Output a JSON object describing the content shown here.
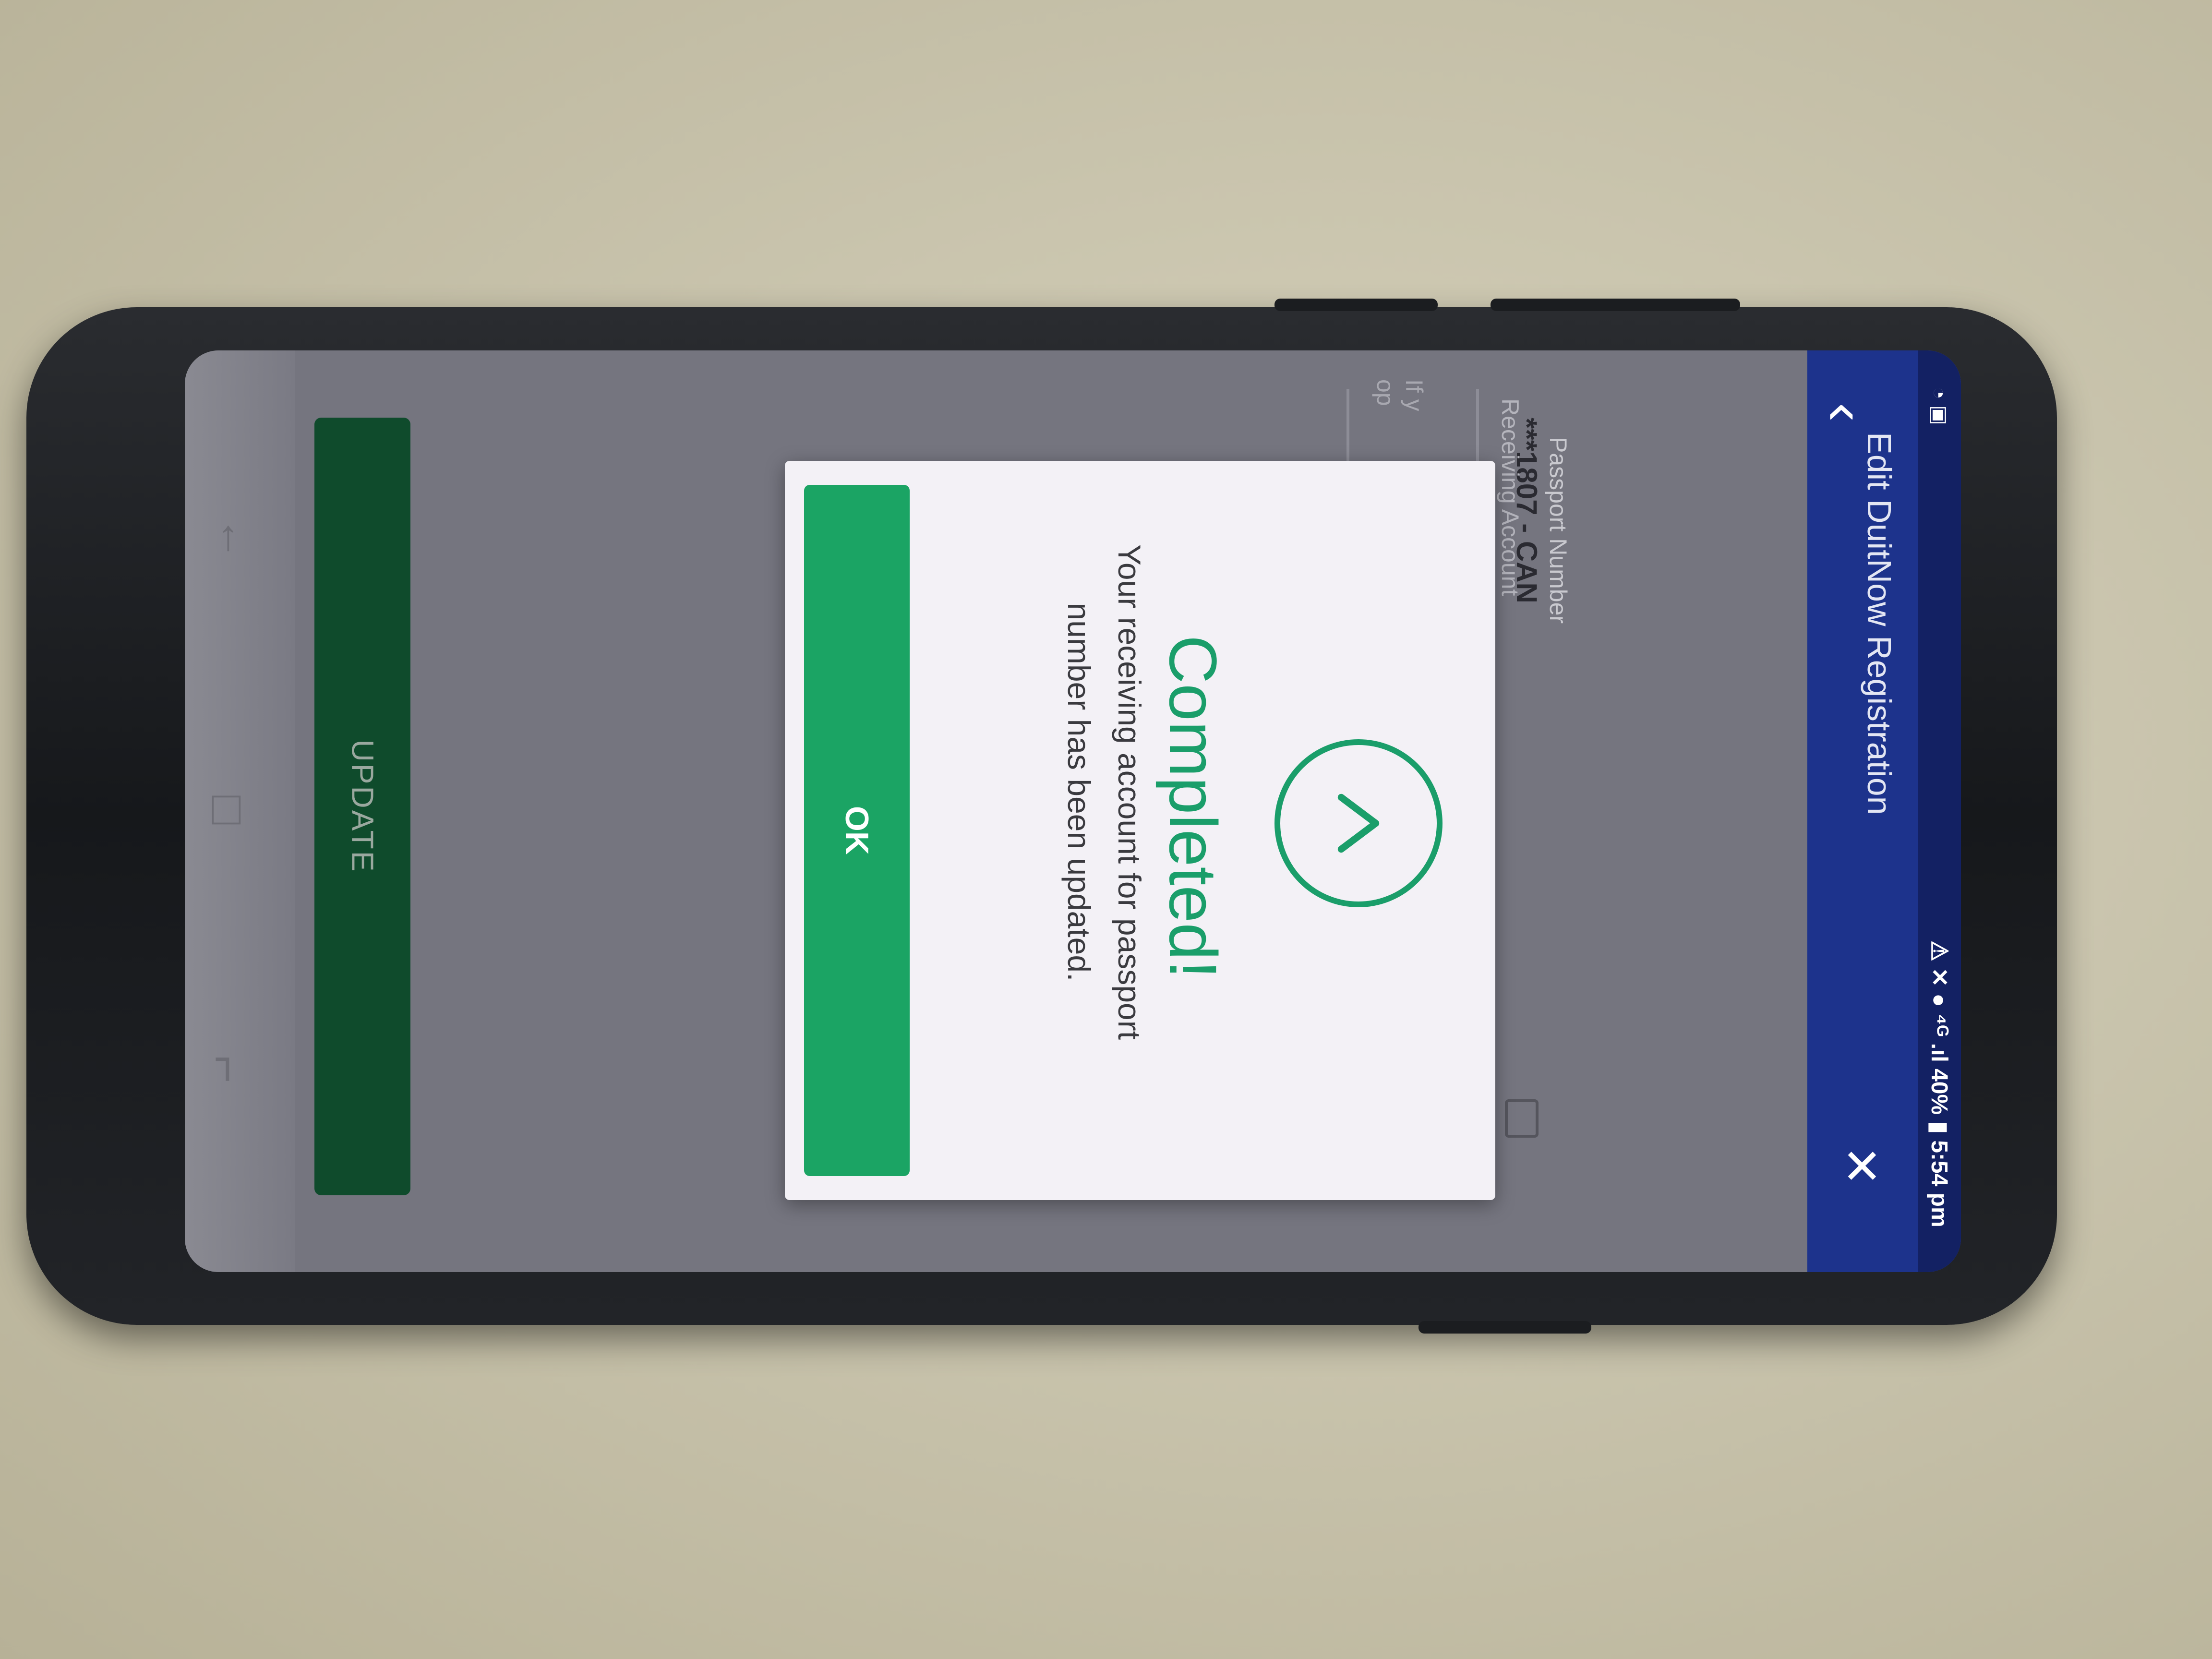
{
  "status_bar": {
    "left_icons": "◔ ▣",
    "right_text": "⚠ ✕ ● ⁴ᴳ .ıl 40% ▮ 5:54 pm"
  },
  "app_bar": {
    "back_icon": "‹",
    "title": "Edit DuitNow Registration",
    "close_icon": "✕"
  },
  "form": {
    "passport_label": "Passport Number",
    "passport_value": "***1807 - CAN",
    "receiving_label": "Receiving Account",
    "hint_line1": "If y",
    "hint_line2": "op"
  },
  "update_button": {
    "label": "UPDATE"
  },
  "dialog": {
    "title": "Completed!",
    "message": "Your receiving account for passport number has been updated.",
    "ok_label": "OK"
  },
  "nav_bar": {
    "back_icon": "←",
    "home_icon": "□",
    "recents_icon": "⌐"
  },
  "colors": {
    "accent_green": "#1ba464",
    "app_bar_blue": "#1d338c",
    "update_button_dark_green": "#0f4b2c"
  }
}
